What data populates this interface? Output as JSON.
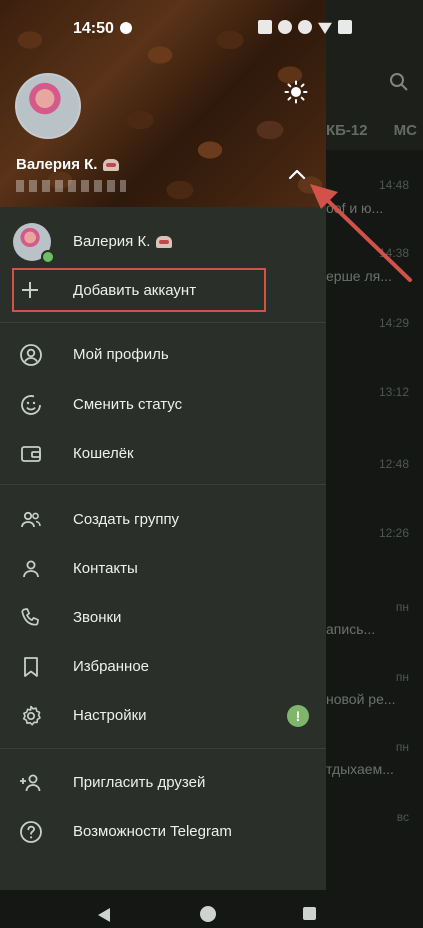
{
  "status_bar": {
    "time": "14:50"
  },
  "background_chats": {
    "tabs": [
      "КБ-12",
      "МС"
    ],
    "rows": [
      {
        "time": "14:48",
        "snippet": "oof и ю..."
      },
      {
        "time": "14:38",
        "snippet": "ерше ля..."
      },
      {
        "time": "14:29",
        "snippet": ""
      },
      {
        "time": "13:12",
        "snippet": ""
      },
      {
        "time": "12:48",
        "snippet": ""
      },
      {
        "time": "12:26",
        "snippet": ""
      },
      {
        "time": "пн",
        "snippet": "апись..."
      },
      {
        "time": "пн",
        "snippet": "новой ре..."
      },
      {
        "time": "пн",
        "snippet": "тдыхаем..."
      },
      {
        "time": "вс",
        "snippet": ""
      }
    ]
  },
  "drawer": {
    "header": {
      "name": "Валерия К."
    },
    "account": {
      "name": "Валерия К."
    },
    "add_account_label": "Добавить аккаунт",
    "menu": {
      "profile": "Мой профиль",
      "status": "Сменить статус",
      "wallet": "Кошелёк",
      "new_group": "Создать группу",
      "contacts": "Контакты",
      "calls": "Звонки",
      "saved": "Избранное",
      "settings": "Настройки",
      "invite": "Пригласить друзей",
      "features": "Возможности Telegram"
    },
    "settings_badge": "!"
  },
  "colors": {
    "drawer_bg": "#2a2f29",
    "highlight_box": "#d2524a",
    "badge_green": "#7fb66b"
  }
}
